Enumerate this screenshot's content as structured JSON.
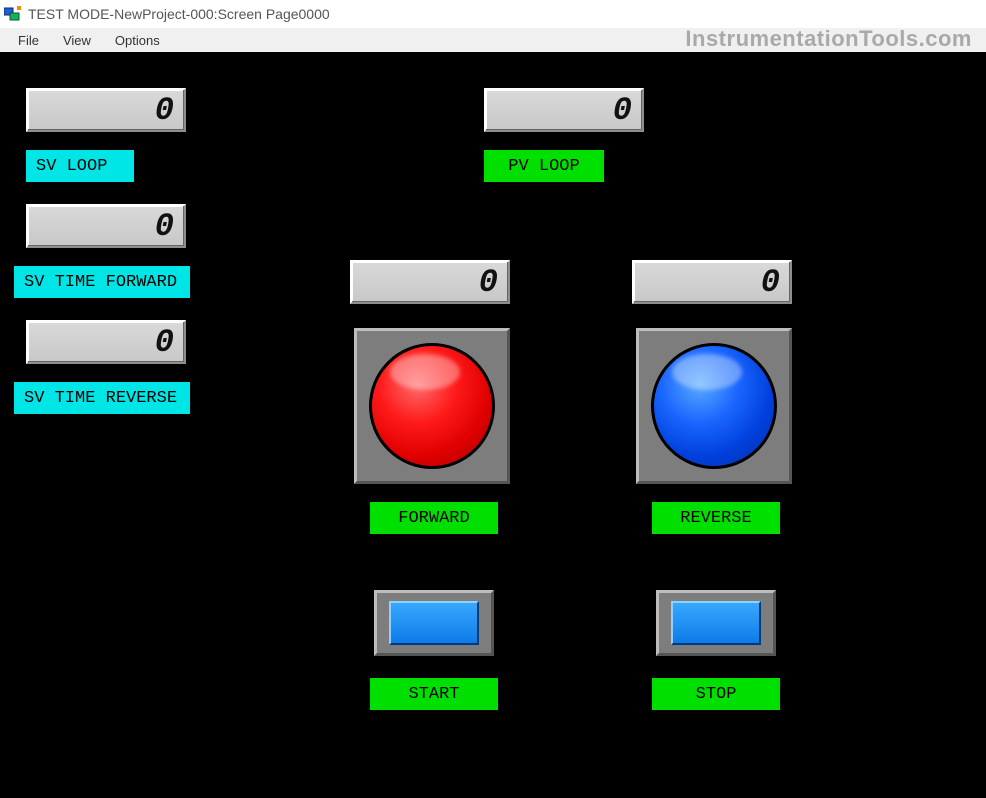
{
  "window": {
    "title": "TEST MODE-NewProject-000:Screen Page0000"
  },
  "menubar": {
    "file": "File",
    "view": "View",
    "options": "Options"
  },
  "watermark": "InstrumentationTools.com",
  "left": {
    "sv_loop": {
      "value": "0",
      "label": "SV LOOP"
    },
    "sv_time_forward": {
      "value": "0",
      "label": "SV TIME FORWARD"
    },
    "sv_time_reverse": {
      "value": "0",
      "label": "SV TIME REVERSE"
    }
  },
  "top": {
    "pv_loop": {
      "value": "0",
      "label": "PV LOOP"
    }
  },
  "center": {
    "forward": {
      "value": "0",
      "label": "FORWARD"
    },
    "reverse": {
      "value": "0",
      "label": "REVERSE"
    },
    "start": {
      "label": "START"
    },
    "stop": {
      "label": "STOP"
    }
  }
}
